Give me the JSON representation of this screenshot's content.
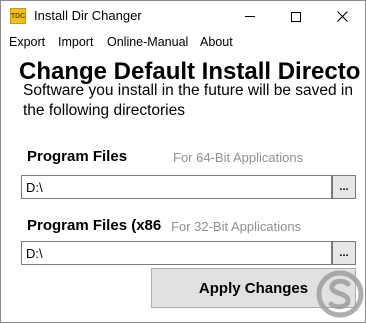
{
  "window": {
    "title": "Install Dir Changer",
    "icon_text": "TDC",
    "icon_color": "#f0c020",
    "controls": [
      "minimize-icon",
      "maximize-icon",
      "close-icon"
    ]
  },
  "menu": {
    "items": [
      "Export",
      "Import",
      "Online-Manual",
      "About"
    ]
  },
  "main": {
    "heading": "Change Default Install Directo",
    "description": "Software you install in the future will be saved in the following directories"
  },
  "program_files_64": {
    "label": "Program Files",
    "hint": "For 64-Bit Applications",
    "value": "D:\\",
    "browse_label": "..."
  },
  "program_files_32": {
    "label": "Program Files (x86",
    "hint": "For 32-Bit Applications",
    "value": "D:\\",
    "browse_label": "..."
  },
  "actions": {
    "apply_label": "Apply Changes"
  },
  "watermark": {
    "icon": "solvetic-logo",
    "color": "#9a9a9a"
  }
}
